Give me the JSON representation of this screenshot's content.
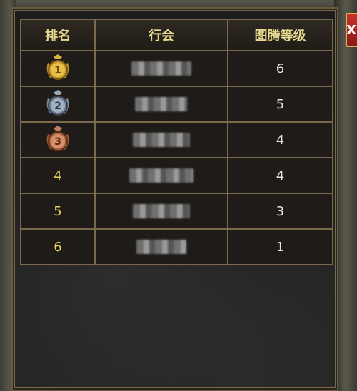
{
  "close_glyph": "X",
  "table": {
    "headers": [
      "排名",
      "行会",
      "图腾等级"
    ],
    "rows": [
      {
        "rank": "1",
        "medal": "gold-medal-icon",
        "guild": "",
        "level": "6"
      },
      {
        "rank": "2",
        "medal": "silver-medal-icon",
        "guild": "",
        "level": "5"
      },
      {
        "rank": "3",
        "medal": "bronze-medal-icon",
        "guild": "",
        "level": "4"
      },
      {
        "rank": "4",
        "medal": "",
        "guild": "",
        "level": "4"
      },
      {
        "rank": "5",
        "medal": "",
        "guild": "",
        "level": "3"
      },
      {
        "rank": "6",
        "medal": "",
        "guild": "",
        "level": "1"
      }
    ]
  },
  "colors": {
    "header_text": "#e8d890",
    "rank_text": "#e6d060",
    "level_text": "#e6e6e6",
    "border": "#7a6a4c",
    "close_bg": "#c8332b"
  }
}
